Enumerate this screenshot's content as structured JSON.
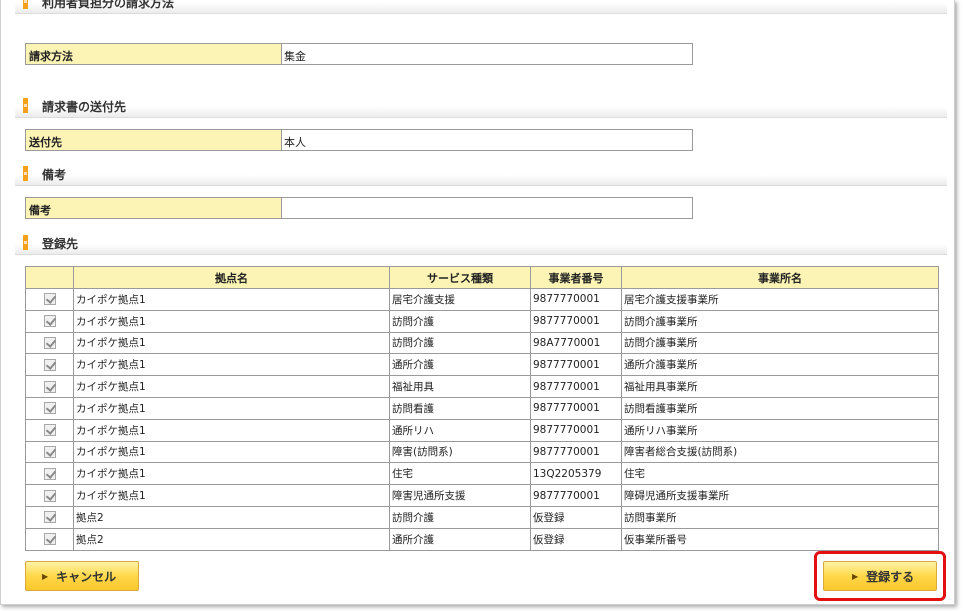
{
  "sections": {
    "billing_payer_method": {
      "title": "利用者負担分の請求方法"
    },
    "invoice_destination": {
      "title": "請求書の送付先"
    },
    "remarks": {
      "title": "備考"
    },
    "registration": {
      "title": "登録先"
    }
  },
  "fields": {
    "billing_method": {
      "label": "請求方法",
      "value": "集金"
    },
    "send_to": {
      "label": "送付先",
      "value": "本人"
    },
    "remarks": {
      "label": "備考",
      "value": ""
    }
  },
  "table": {
    "headers": [
      "",
      "拠点名",
      "サービス種類",
      "事業者番号",
      "事業所名"
    ],
    "rows": [
      {
        "checked": true,
        "base": "カイポケ拠点1",
        "service": "居宅介護支援",
        "provider_no": "9877770001",
        "office": "居宅介護支援事業所"
      },
      {
        "checked": true,
        "base": "カイポケ拠点1",
        "service": "訪問介護",
        "provider_no": "9877770001",
        "office": "訪問介護事業所"
      },
      {
        "checked": true,
        "base": "カイポケ拠点1",
        "service": "訪問介護",
        "provider_no": "98A7770001",
        "office": "訪問介護事業所"
      },
      {
        "checked": true,
        "base": "カイポケ拠点1",
        "service": "通所介護",
        "provider_no": "9877770001",
        "office": "通所介護事業所"
      },
      {
        "checked": true,
        "base": "カイポケ拠点1",
        "service": "福祉用具",
        "provider_no": "9877770001",
        "office": "福祉用具事業所"
      },
      {
        "checked": true,
        "base": "カイポケ拠点1",
        "service": "訪問看護",
        "provider_no": "9877770001",
        "office": "訪問看護事業所"
      },
      {
        "checked": true,
        "base": "カイポケ拠点1",
        "service": "通所リハ",
        "provider_no": "9877770001",
        "office": "通所リハ事業所"
      },
      {
        "checked": true,
        "base": "カイポケ拠点1",
        "service": "障害(訪問系)",
        "provider_no": "9877770001",
        "office": "障害者総合支援(訪問系)"
      },
      {
        "checked": true,
        "base": "カイポケ拠点1",
        "service": "住宅",
        "provider_no": "13Q2205379",
        "office": "住宅"
      },
      {
        "checked": true,
        "base": "カイポケ拠点1",
        "service": "障害児通所支援",
        "provider_no": "9877770001",
        "office": "障碍児通所支援事業所"
      },
      {
        "checked": true,
        "base": "拠点2",
        "service": "訪問介護",
        "provider_no": "仮登録",
        "office": "訪問事業所"
      },
      {
        "checked": true,
        "base": "拠点2",
        "service": "通所介護",
        "provider_no": "仮登録",
        "office": "仮事業所番号"
      }
    ]
  },
  "buttons": {
    "cancel": "キャンセル",
    "register": "登録する"
  },
  "colors": {
    "accent_orange": "#f4a21c",
    "label_bg": "#fbf4b4",
    "button_yellow": "#ffd84a",
    "highlight_red": "#e21010"
  }
}
